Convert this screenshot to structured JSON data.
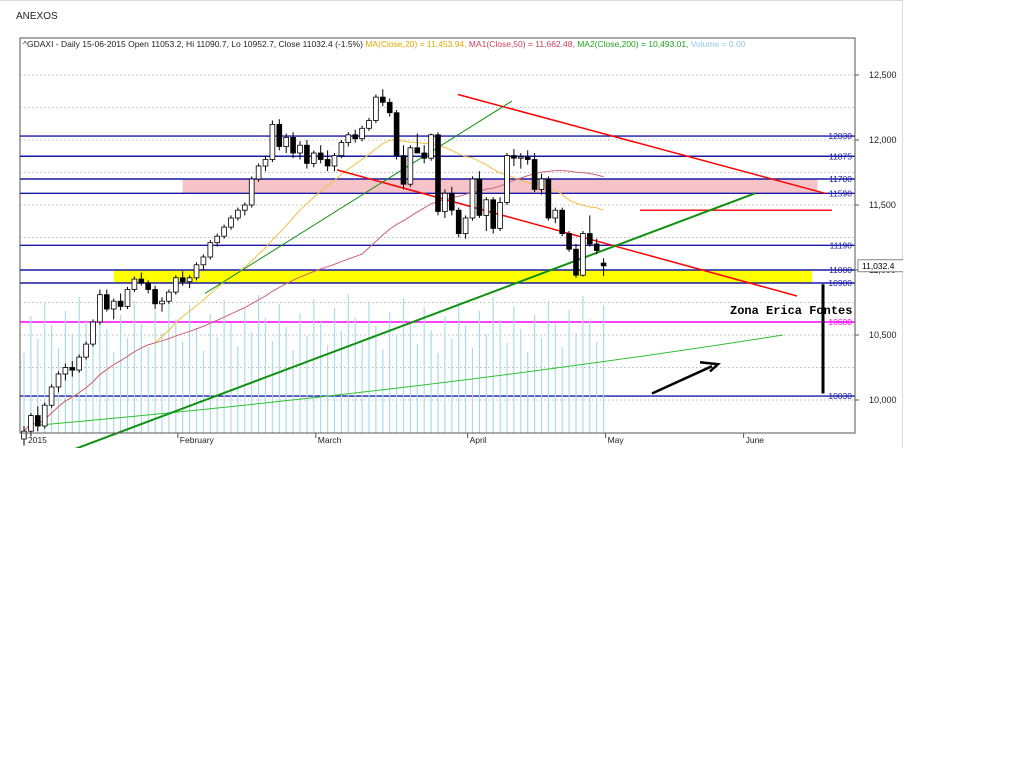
{
  "page": {
    "title": "ANEXOS"
  },
  "chart_data": {
    "type": "candlestick",
    "symbol": "^GDAXI",
    "header": {
      "prefix": "^GDAXI - Daily 15-06-2015 Open 11053.2, Hi 11090.7, Lo 10952.7, Close 11032.4 (-1.5%)",
      "ma": "MA(Close,20) = 11,453.94,",
      "ma1": "MA1(Close,50) = 11,662.48,",
      "ma2": "MA2(Close,200) = 10,493.01,",
      "volume": "Volume = 0.00"
    },
    "colors": {
      "ma": "#f0c040",
      "ma1": "#d0607a",
      "ma2": "#30c030",
      "volume": "#a8dce8",
      "trend_red": "#ff0000",
      "trend_green": "#109010",
      "band_pink": "#f4b8c0",
      "band_yellow": "#ffff00",
      "level_blue": "#1a1aa8",
      "level_magenta": "#ff00ff"
    },
    "yaxis": {
      "min": 9500,
      "max": 12550,
      "ticks": [
        "12,500",
        "12,000",
        "11,500",
        "11,000",
        "10,500",
        "10,000"
      ]
    },
    "xaxis": {
      "labels": [
        {
          "text": "2015",
          "index": 0
        },
        {
          "text": "February",
          "index": 22
        },
        {
          "text": "March",
          "index": 42
        },
        {
          "text": "April",
          "index": 64
        },
        {
          "text": "May",
          "index": 84
        },
        {
          "text": "June",
          "index": 104
        }
      ]
    },
    "last_price": "11,032.4",
    "levels": [
      {
        "value": 12030,
        "label": "12030",
        "color": "#1a1aa8"
      },
      {
        "value": 11875,
        "label": "11875",
        "color": "#1a1aa8"
      },
      {
        "value": 11700,
        "label": "11700",
        "color": "#1a1aa8"
      },
      {
        "value": 11590,
        "label": "11590",
        "color": "#1a1aa8"
      },
      {
        "value": 11190,
        "label": "11190",
        "color": "#1a1aa8"
      },
      {
        "value": 11000,
        "label": "11000",
        "color": "#1a1aa8"
      },
      {
        "value": 10900,
        "label": "10900",
        "color": "#1a1aa8"
      },
      {
        "value": 10600,
        "label": "10600",
        "color": "#ff00ff"
      },
      {
        "value": 10030,
        "label": "10030",
        "color": "#1a1aa8"
      }
    ],
    "annotation": "Zona Erica Fontes",
    "candles": [
      [
        9700,
        9800,
        9650,
        9760
      ],
      [
        9760,
        9900,
        9720,
        9880
      ],
      [
        9880,
        9950,
        9760,
        9800
      ],
      [
        9800,
        9980,
        9780,
        9960
      ],
      [
        9960,
        10120,
        9940,
        10100
      ],
      [
        10100,
        10220,
        10060,
        10200
      ],
      [
        10200,
        10280,
        10150,
        10250
      ],
      [
        10250,
        10300,
        10180,
        10230
      ],
      [
        10230,
        10350,
        10210,
        10330
      ],
      [
        10330,
        10450,
        10310,
        10430
      ],
      [
        10430,
        10620,
        10410,
        10600
      ],
      [
        10600,
        10850,
        10580,
        10810
      ],
      [
        10810,
        10850,
        10680,
        10700
      ],
      [
        10700,
        10780,
        10620,
        10760
      ],
      [
        10760,
        10820,
        10690,
        10720
      ],
      [
        10720,
        10870,
        10700,
        10850
      ],
      [
        10850,
        10950,
        10830,
        10930
      ],
      [
        10930,
        10980,
        10880,
        10900
      ],
      [
        10900,
        10920,
        10820,
        10850
      ],
      [
        10850,
        10880,
        10700,
        10740
      ],
      [
        10740,
        10790,
        10680,
        10760
      ],
      [
        10760,
        10850,
        10740,
        10830
      ],
      [
        10830,
        10960,
        10810,
        10940
      ],
      [
        10940,
        10990,
        10880,
        10910
      ],
      [
        10910,
        10960,
        10860,
        10940
      ],
      [
        10940,
        11060,
        10920,
        11040
      ],
      [
        11040,
        11120,
        11000,
        11100
      ],
      [
        11100,
        11230,
        11080,
        11210
      ],
      [
        11210,
        11280,
        11180,
        11260
      ],
      [
        11260,
        11350,
        11240,
        11330
      ],
      [
        11330,
        11420,
        11310,
        11400
      ],
      [
        11400,
        11480,
        11380,
        11460
      ],
      [
        11460,
        11520,
        11420,
        11500
      ],
      [
        11500,
        11720,
        11480,
        11700
      ],
      [
        11700,
        11820,
        11680,
        11800
      ],
      [
        11800,
        11880,
        11760,
        11850
      ],
      [
        11850,
        12150,
        11830,
        12120
      ],
      [
        12120,
        12160,
        11920,
        11950
      ],
      [
        11950,
        12050,
        11900,
        12020
      ],
      [
        12020,
        12060,
        11860,
        11900
      ],
      [
        11900,
        11990,
        11850,
        11960
      ],
      [
        11960,
        12000,
        11780,
        11820
      ],
      [
        11820,
        11920,
        11790,
        11900
      ],
      [
        11900,
        11960,
        11820,
        11850
      ],
      [
        11850,
        11920,
        11760,
        11800
      ],
      [
        11800,
        11900,
        11760,
        11880
      ],
      [
        11880,
        12000,
        11860,
        11980
      ],
      [
        11980,
        12060,
        11950,
        12040
      ],
      [
        12040,
        12080,
        11980,
        12010
      ],
      [
        12010,
        12110,
        11990,
        12090
      ],
      [
        12090,
        12170,
        12070,
        12150
      ],
      [
        12150,
        12350,
        12130,
        12330
      ],
      [
        12330,
        12390,
        12260,
        12290
      ],
      [
        12290,
        12320,
        12180,
        12210
      ],
      [
        12210,
        12230,
        11850,
        11880
      ],
      [
        11880,
        11960,
        11620,
        11660
      ],
      [
        11660,
        11960,
        11640,
        11940
      ],
      [
        11940,
        12050,
        11900,
        11900
      ],
      [
        11900,
        11960,
        11820,
        11860
      ],
      [
        11860,
        12050,
        11840,
        12040
      ],
      [
        12040,
        12060,
        11420,
        11450
      ],
      [
        11450,
        11620,
        11400,
        11590
      ],
      [
        11590,
        11640,
        11420,
        11460
      ],
      [
        11460,
        11480,
        11250,
        11280
      ],
      [
        11280,
        11420,
        11240,
        11400
      ],
      [
        11400,
        11720,
        11380,
        11700
      ],
      [
        11700,
        11760,
        11400,
        11420
      ],
      [
        11420,
        11560,
        11300,
        11540
      ],
      [
        11540,
        11560,
        11280,
        11320
      ],
      [
        11320,
        11560,
        11300,
        11520
      ],
      [
        11520,
        11900,
        11500,
        11880
      ],
      [
        11880,
        11930,
        11800,
        11860
      ],
      [
        11860,
        11900,
        11780,
        11870
      ],
      [
        11870,
        11920,
        11810,
        11850
      ],
      [
        11850,
        11900,
        11600,
        11620
      ],
      [
        11620,
        11740,
        11580,
        11700
      ],
      [
        11700,
        11720,
        11380,
        11400
      ],
      [
        11400,
        11480,
        11360,
        11460
      ],
      [
        11460,
        11480,
        11260,
        11280
      ],
      [
        11280,
        11300,
        11140,
        11160
      ],
      [
        11160,
        11200,
        10940,
        10960
      ],
      [
        10960,
        11300,
        10950,
        11280
      ],
      [
        11280,
        11420,
        11180,
        11200
      ],
      [
        11200,
        11240,
        11120,
        11150
      ],
      [
        11053.2,
        11090.7,
        10952.7,
        11032.4
      ]
    ]
  }
}
